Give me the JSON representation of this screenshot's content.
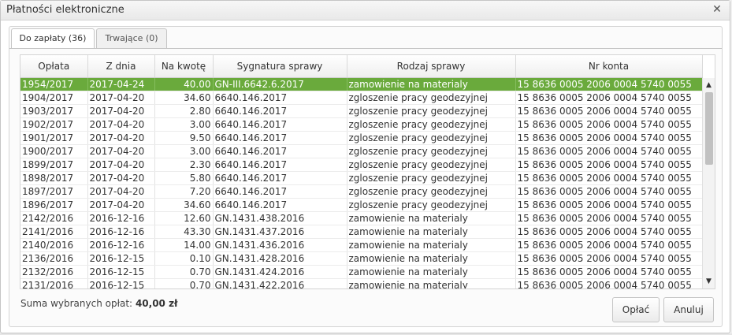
{
  "window": {
    "title": "Płatności elektroniczne",
    "close_icon": "close-icon"
  },
  "tabs": [
    {
      "label": "Do zapłaty (36)",
      "active": true
    },
    {
      "label": "Trwające (0)",
      "active": false
    }
  ],
  "table": {
    "columns": [
      "Opłata",
      "Z dnia",
      "Na kwotę",
      "Sygnatura sprawy",
      "Rodzaj sprawy",
      "Nr konta"
    ],
    "rows": [
      [
        "1954/2017",
        "2017-04-24",
        "40.00",
        "GN-III.6642.6.2017",
        "zamowienie na materialy",
        "15 8636 0005 2006 0004 5740 0055"
      ],
      [
        "1904/2017",
        "2017-04-20",
        "34.60",
        "6640.146.2017",
        "zgloszenie pracy geodezyjnej",
        "15 8636 0005 2006 0004 5740 0055"
      ],
      [
        "1903/2017",
        "2017-04-20",
        "2.80",
        "6640.146.2017",
        "zgloszenie pracy geodezyjnej",
        "15 8636 0005 2006 0004 5740 0055"
      ],
      [
        "1902/2017",
        "2017-04-20",
        "3.00",
        "6640.146.2017",
        "zgloszenie pracy geodezyjnej",
        "15 8636 0005 2006 0004 5740 0055"
      ],
      [
        "1901/2017",
        "2017-04-20",
        "9.50",
        "6640.146.2017",
        "zgloszenie pracy geodezyjnej",
        "15 8636 0005 2006 0004 5740 0055"
      ],
      [
        "1900/2017",
        "2017-04-20",
        "3.00",
        "6640.146.2017",
        "zgloszenie pracy geodezyjnej",
        "15 8636 0005 2006 0004 5740 0055"
      ],
      [
        "1899/2017",
        "2017-04-20",
        "2.30",
        "6640.146.2017",
        "zgloszenie pracy geodezyjnej",
        "15 8636 0005 2006 0004 5740 0055"
      ],
      [
        "1898/2017",
        "2017-04-20",
        "5.80",
        "6640.146.2017",
        "zgloszenie pracy geodezyjnej",
        "15 8636 0005 2006 0004 5740 0055"
      ],
      [
        "1897/2017",
        "2017-04-20",
        "7.20",
        "6640.146.2017",
        "zgloszenie pracy geodezyjnej",
        "15 8636 0005 2006 0004 5740 0055"
      ],
      [
        "1896/2017",
        "2017-04-20",
        "34.60",
        "6640.146.2017",
        "zgloszenie pracy geodezyjnej",
        "15 8636 0005 2006 0004 5740 0055"
      ],
      [
        "2142/2016",
        "2016-12-16",
        "12.60",
        "GN.1431.438.2016",
        "zamowienie na materialy",
        "15 8636 0005 2006 0004 5740 0055"
      ],
      [
        "2141/2016",
        "2016-12-16",
        "43.30",
        "GN.1431.437.2016",
        "zamowienie na materialy",
        "15 8636 0005 2006 0004 5740 0055"
      ],
      [
        "2140/2016",
        "2016-12-16",
        "14.00",
        "GN.1431.436.2016",
        "zamowienie na materialy",
        "15 8636 0005 2006 0004 5740 0055"
      ],
      [
        "2136/2016",
        "2016-12-15",
        "0.10",
        "GN.1431.428.2016",
        "zamowienie na materialy",
        "15 8636 0005 2006 0004 5740 0055"
      ],
      [
        "2132/2016",
        "2016-12-15",
        "0.70",
        "GN.1431.424.2016",
        "zamowienie na materialy",
        "15 8636 0005 2006 0004 5740 0055"
      ],
      [
        "2131/2016",
        "2016-12-15",
        "0.70",
        "GN.1431.422.2016",
        "zamowienie na materialy",
        "15 8636 0005 2006 0004 5740 0055"
      ]
    ],
    "selected_row": 0,
    "selected_color": "#6aaa3c"
  },
  "footer": {
    "sum_label": "Suma wybranych opłat:",
    "sum_value": "40,00 zł",
    "pay_label": "Opłać",
    "cancel_label": "Anuluj"
  }
}
